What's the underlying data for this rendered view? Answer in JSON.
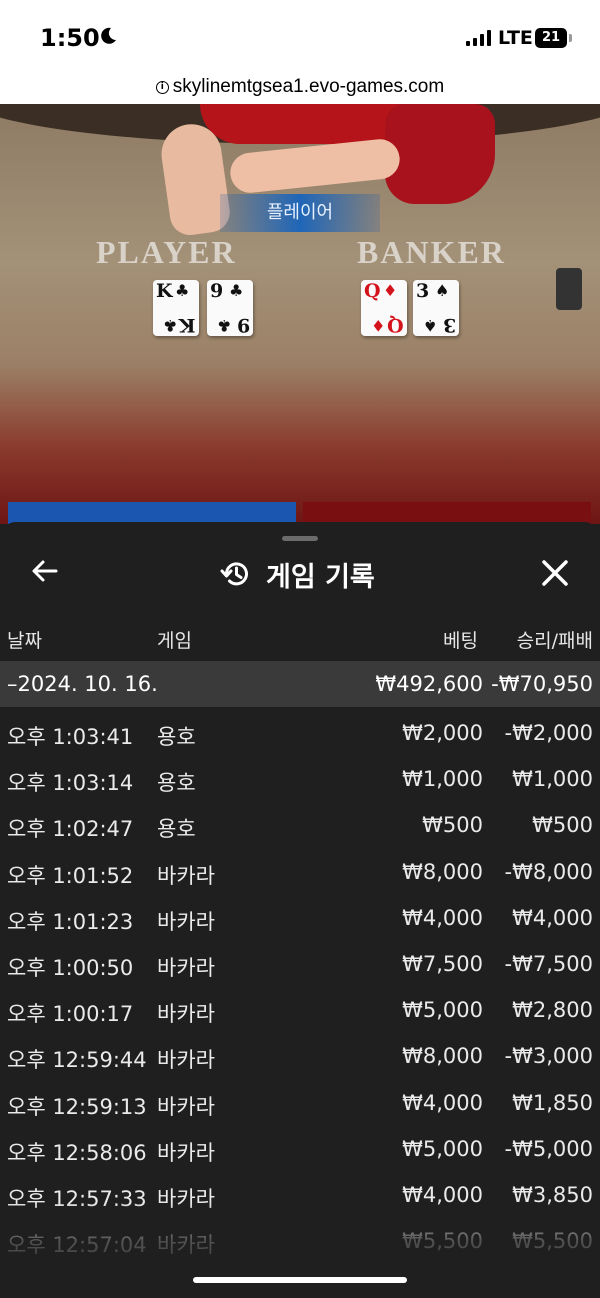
{
  "status_bar": {
    "time": "1:50",
    "network": "LTE",
    "battery": "21"
  },
  "browser": {
    "url": "skylinemtgsea1.evo-games.com"
  },
  "live_table": {
    "winner_banner": "플레이어",
    "player_label": "PLAYER",
    "banker_label": "BANKER",
    "player_cards": [
      {
        "rank": "K",
        "suit": "♣",
        "color": "#111111"
      },
      {
        "rank": "9",
        "suit": "♣",
        "color": "#111111"
      }
    ],
    "banker_cards": [
      {
        "rank": "Q",
        "suit": "♦",
        "color": "#d4121b"
      },
      {
        "rank": "3",
        "suit": "♠",
        "color": "#111111"
      }
    ]
  },
  "sheet": {
    "title": "게임 기록",
    "back_icon": "arrow-left-icon",
    "close_icon": "close-icon",
    "history_icon": "history-icon",
    "columns": {
      "date": "날짜",
      "game": "게임",
      "bet": "베팅",
      "result": "승리/패배"
    },
    "date_group": {
      "date": "–2024. 10. 16.",
      "total_bet": "₩492,600",
      "total_result": "-₩70,950"
    },
    "rows": [
      {
        "time": "오후 1:03:41",
        "game": "용호",
        "bet": "₩2,000",
        "result": "-₩2,000"
      },
      {
        "time": "오후 1:03:14",
        "game": "용호",
        "bet": "₩1,000",
        "result": "₩1,000"
      },
      {
        "time": "오후 1:02:47",
        "game": "용호",
        "bet": "₩500",
        "result": "₩500"
      },
      {
        "time": "오후 1:01:52",
        "game": "바카라",
        "bet": "₩8,000",
        "result": "-₩8,000"
      },
      {
        "time": "오후 1:01:23",
        "game": "바카라",
        "bet": "₩4,000",
        "result": "₩4,000"
      },
      {
        "time": "오후 1:00:50",
        "game": "바카라",
        "bet": "₩7,500",
        "result": "-₩7,500"
      },
      {
        "time": "오후 1:00:17",
        "game": "바카라",
        "bet": "₩5,000",
        "result": "₩2,800"
      },
      {
        "time": "오후 12:59:44",
        "game": "바카라",
        "bet": "₩8,000",
        "result": "-₩3,000"
      },
      {
        "time": "오후 12:59:13",
        "game": "바카라",
        "bet": "₩4,000",
        "result": "₩1,850"
      },
      {
        "time": "오후 12:58:06",
        "game": "바카라",
        "bet": "₩5,000",
        "result": "-₩5,000"
      },
      {
        "time": "오후 12:57:33",
        "game": "바카라",
        "bet": "₩4,000",
        "result": "₩3,850"
      },
      {
        "time": "오후 12:57:04",
        "game": "바카라",
        "bet": "₩5,500",
        "result": "₩5,500"
      }
    ]
  }
}
